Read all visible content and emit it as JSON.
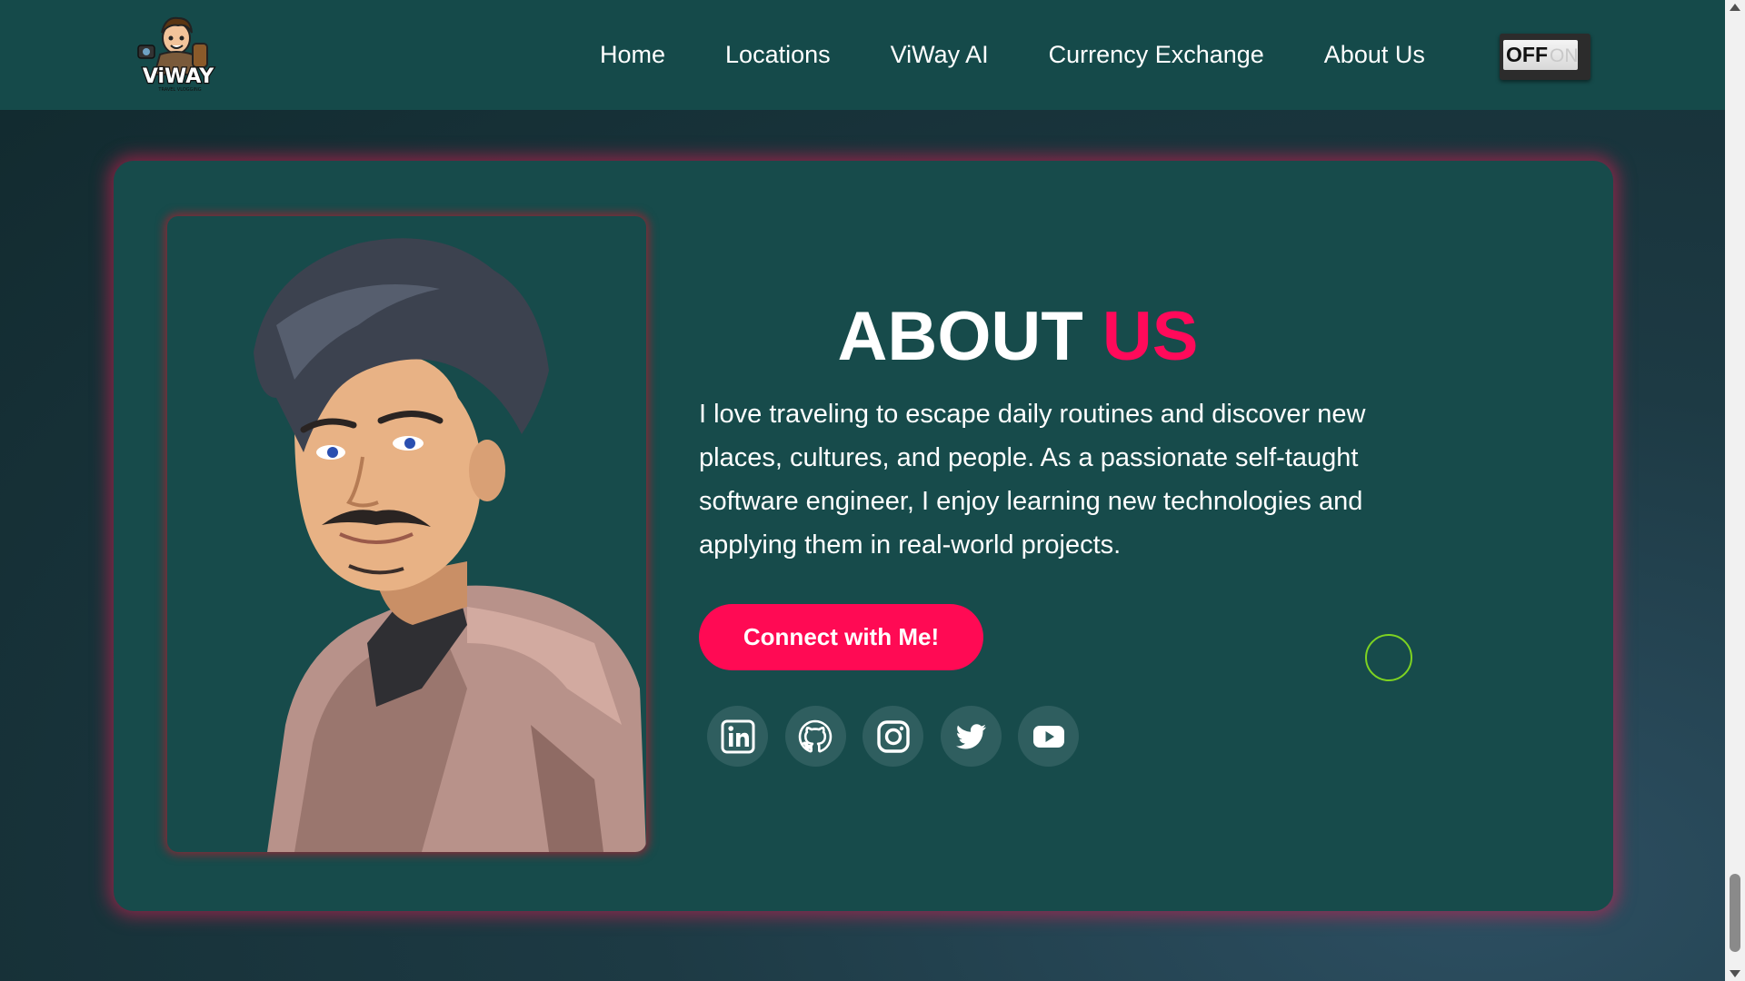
{
  "navbar": {
    "logo": {
      "name": "viway-logo",
      "text": "ViWAY",
      "tagline": "TRAVEL VLOGGING"
    },
    "links": [
      {
        "label": "Home"
      },
      {
        "label": "Locations"
      },
      {
        "label": "ViWay AI"
      },
      {
        "label": "Currency Exchange"
      },
      {
        "label": "About Us"
      }
    ],
    "theme_toggle": {
      "off_label": "OFF",
      "on_label": "ON",
      "state": "off"
    }
  },
  "about": {
    "title_main": "ABOUT",
    "title_accent": "US",
    "paragraph": "I love traveling to escape daily routines and discover new places, cultures, and people. As a passionate self-taught software engineer, I enjoy learning new technologies and applying them in real-world projects.",
    "cta_label": "Connect with Me!",
    "portrait_icon": "portrait-illustration",
    "socials": [
      {
        "icon": "linkedin-icon"
      },
      {
        "icon": "github-icon"
      },
      {
        "icon": "instagram-icon"
      },
      {
        "icon": "twitter-icon"
      },
      {
        "icon": "youtube-icon"
      }
    ]
  },
  "colors": {
    "navbar_bg": "#154a4a",
    "card_bg": "#174b4b",
    "accent": "#ff0a54",
    "glow": "#dc1e50",
    "cursor_ring": "#7ed321"
  }
}
